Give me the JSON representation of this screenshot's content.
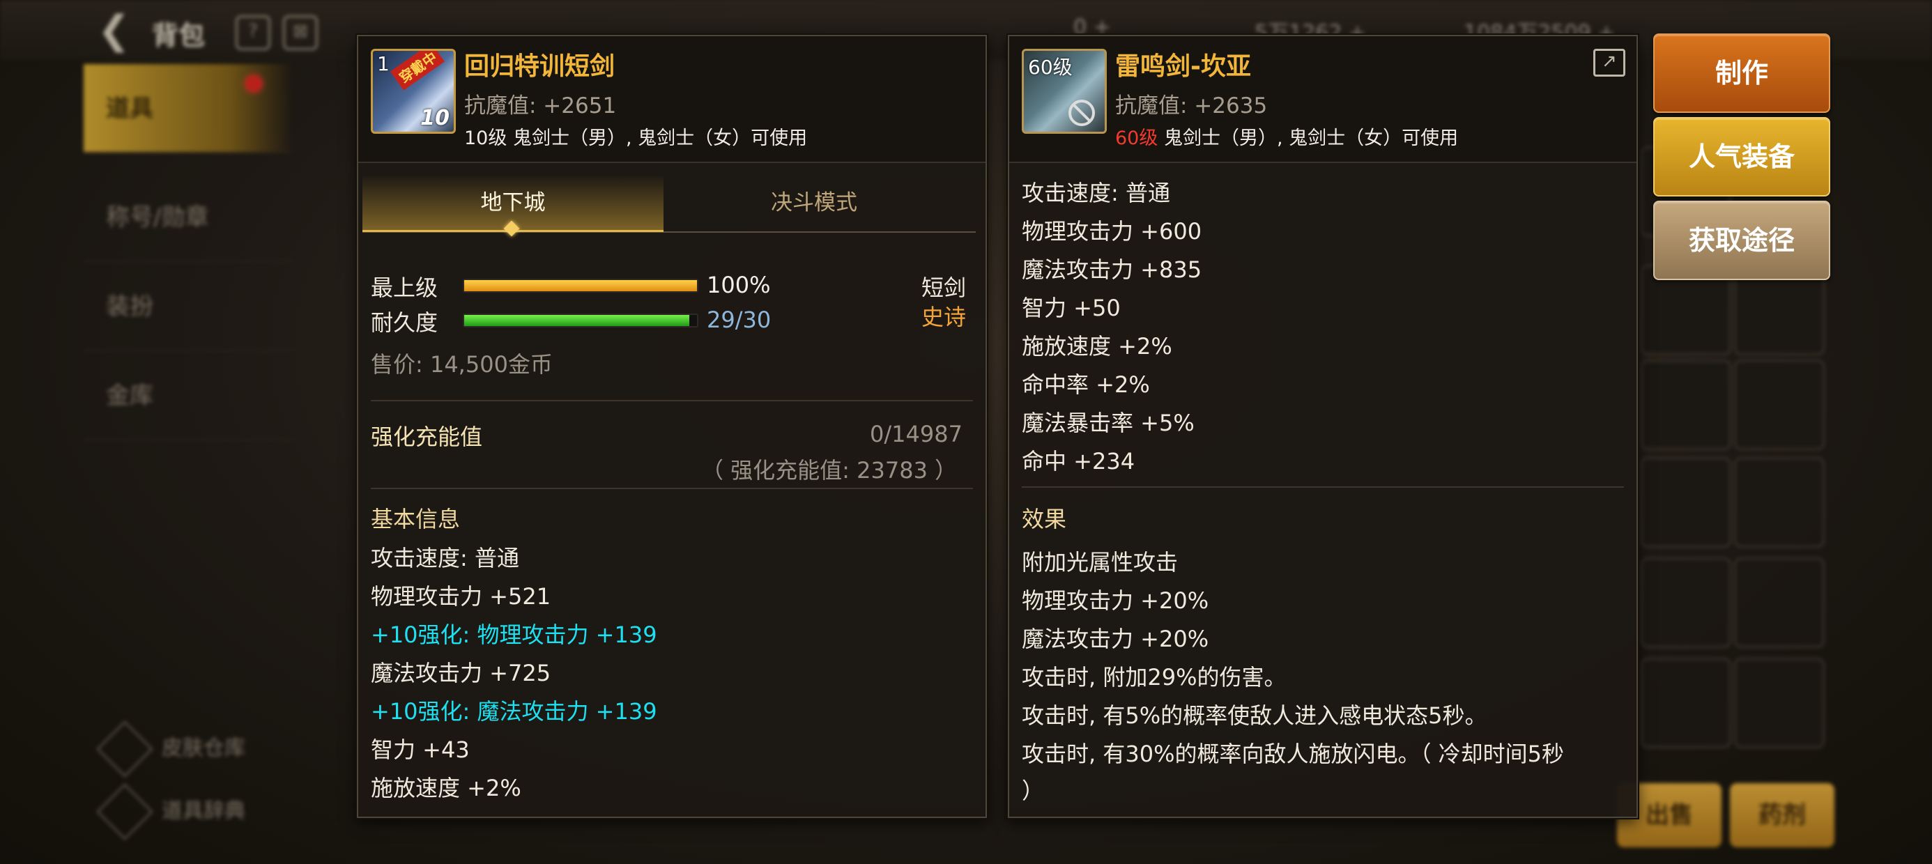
{
  "background": {
    "title": "背包",
    "currency": [
      "0 +",
      "5万1262 +",
      "1084万2509 +"
    ],
    "nav": [
      "道具",
      "称号/勋章",
      "装扮",
      "金库"
    ],
    "bottom_links": [
      "皮肤仓库",
      "道具辞典"
    ],
    "bottom_buttons": [
      "出售",
      "药剂"
    ]
  },
  "side_buttons": {
    "make": "制作",
    "popular": "人气装备",
    "obtain": "获取途径"
  },
  "left_item": {
    "icon_level": "1",
    "icon_badge": "穿戴中",
    "icon_plus": "10",
    "name": "回归特训短剑",
    "resist": "抗魔值: +2651",
    "usable": "10级 鬼剑士（男）, 鬼剑士（女）可使用",
    "tabs": [
      "地下城",
      "决斗模式"
    ],
    "grade_label": "最上级",
    "grade_percent": 100,
    "grade_value": "100%",
    "durability_label": "耐久度",
    "durability_current": 29,
    "durability_max": 30,
    "durability_value": "29/30",
    "weapon_type": "短剑",
    "rarity": "史诗",
    "price": "售价: 14,500金币",
    "reinforce_label": "强化充能值",
    "reinforce_value": "0/14987",
    "reinforce_total": "（ 强化充能值: 23783 ）",
    "basic_title": "基本信息",
    "stats": [
      "攻击速度: 普通",
      "物理攻击力 +521",
      "+10强化: 物理攻击力 +139",
      "魔法攻击力 +725",
      "+10强化: 魔法攻击力 +139",
      "智力 +43",
      "施放速度 +2%"
    ]
  },
  "right_item": {
    "icon_level": "60级",
    "name": "雷鸣剑-坎亚",
    "resist": "抗魔值: +2635",
    "usable_level": "60级",
    "usable_rest": " 鬼剑士（男）, 鬼剑士（女）可使用",
    "stats": [
      "攻击速度: 普通",
      "物理攻击力 +600",
      "魔法攻击力 +835",
      "智力 +50",
      "施放速度 +2%",
      "命中率 +2%",
      "魔法暴击率 +5%",
      "命中 +234"
    ],
    "effect_title": "效果",
    "effects": [
      "附加光属性攻击",
      "物理攻击力 +20%",
      "魔法攻击力 +20%",
      "攻击时, 附加29%的伤害。",
      "攻击时, 有5%的概率使敌人进入感电状态5秒。",
      "攻击时, 有30%的概率向敌人施放闪电。（ 冷却时间5秒",
      "）"
    ]
  },
  "colors": {
    "gold": "#f2b73a",
    "cyan": "#1ee0f0",
    "red": "#f23b2d",
    "orange": "#f3a43a"
  }
}
